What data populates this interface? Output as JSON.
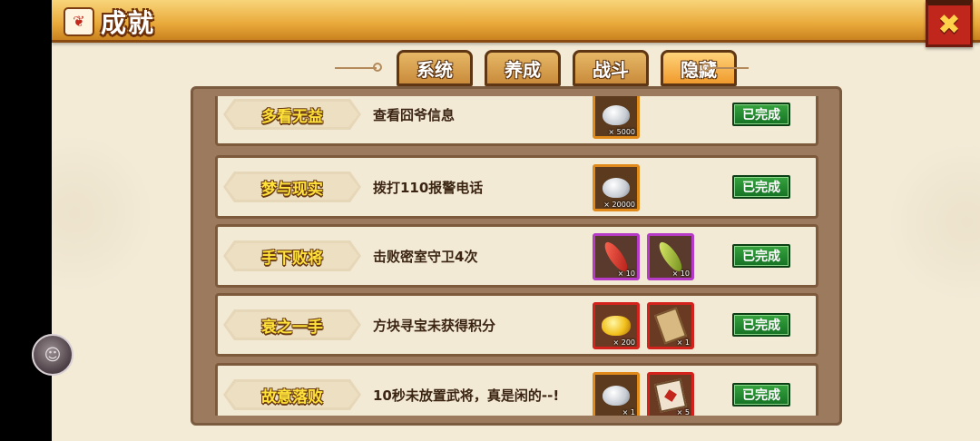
{
  "header": {
    "title": "成就",
    "title_icon": "scroll-badge-icon",
    "close_icon": "close-x-icon"
  },
  "tabs": [
    {
      "label": "系统",
      "active": false
    },
    {
      "label": "养成",
      "active": false
    },
    {
      "label": "战斗",
      "active": false
    },
    {
      "label": "隐藏",
      "active": true
    }
  ],
  "achievements": [
    {
      "name": "多看无益",
      "desc": "查看囧爷信息",
      "status": "已完成",
      "rewards": [
        {
          "item": "silver-ingot",
          "count": "× 5000",
          "frame": "orange"
        }
      ]
    },
    {
      "name": "梦与现实",
      "desc": "拨打110报警电话",
      "status": "已完成",
      "rewards": [
        {
          "item": "silver-ingot",
          "count": "× 20000",
          "frame": "orange"
        }
      ]
    },
    {
      "name": "手下败将",
      "desc": "击败密室守卫4次",
      "status": "已完成",
      "rewards": [
        {
          "item": "red-feather",
          "count": "× 10",
          "frame": "purple"
        },
        {
          "item": "green-feather",
          "count": "× 10",
          "frame": "purple"
        }
      ]
    },
    {
      "name": "衰之一手",
      "desc": "方块寻宝未获得积分",
      "status": "已完成",
      "rewards": [
        {
          "item": "gold-ingot",
          "count": "× 200",
          "frame": "red"
        },
        {
          "item": "scroll",
          "count": "× 1",
          "frame": "red"
        }
      ]
    },
    {
      "name": "故意落败",
      "desc": "10秒未放置武将，真是闲的--!",
      "status": "已完成",
      "rewards": [
        {
          "item": "silver-ingot",
          "count": "× 1",
          "frame": "orange"
        },
        {
          "item": "cards",
          "count": "× 5",
          "frame": "red"
        }
      ]
    }
  ],
  "colors": {
    "accent": "#f09a2c",
    "status_green": "#147224",
    "purple_frame": "#b63cc7",
    "red_frame": "#d4221c",
    "orange_frame": "#e08a1c"
  }
}
